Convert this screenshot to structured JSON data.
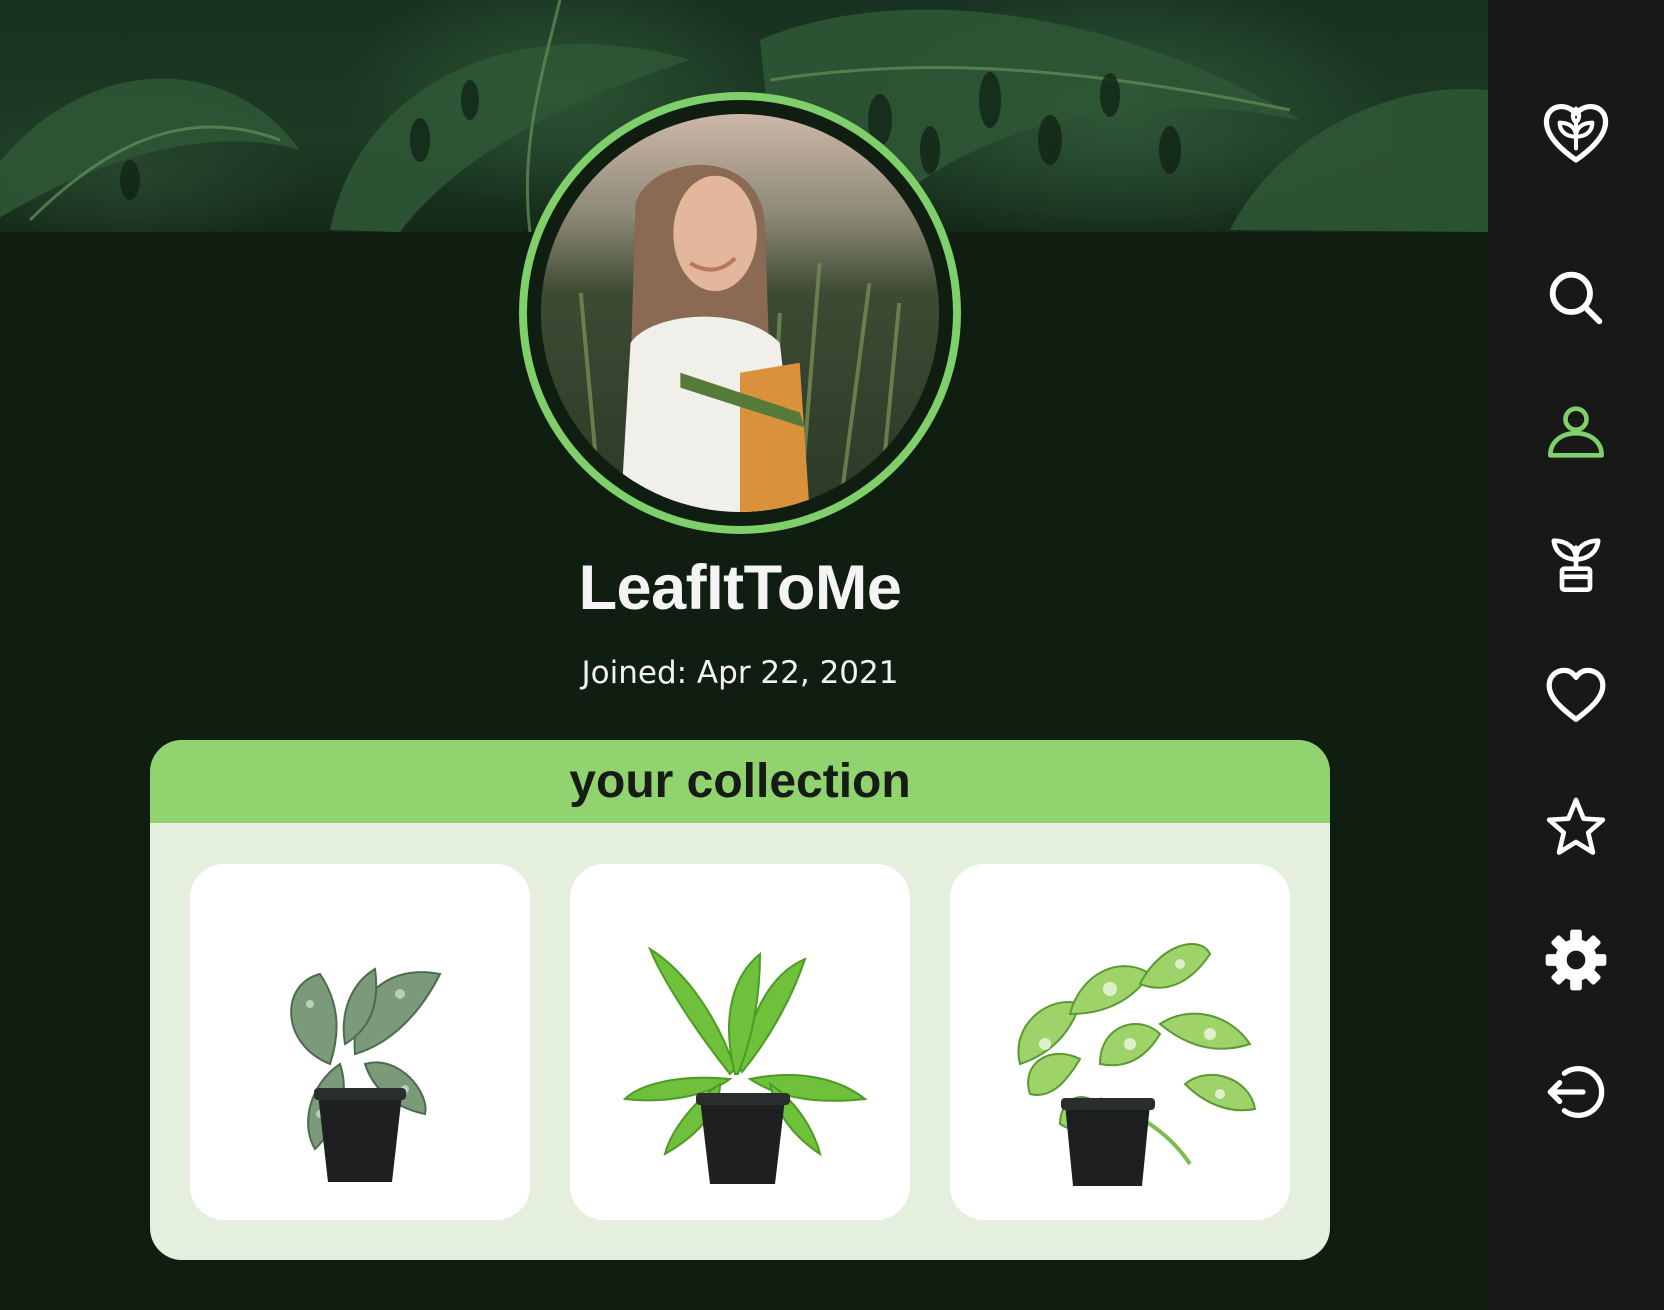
{
  "profile": {
    "username": "LeafItToMe",
    "joined": "Joined: Apr 22, 2021"
  },
  "collection": {
    "title": "your collection",
    "plants": [
      {
        "icon": "calathea-potted-plant"
      },
      {
        "icon": "birds-nest-fern-potted-plant"
      },
      {
        "icon": "pothos-potted-plant"
      }
    ]
  },
  "sidebar": {
    "items": [
      {
        "icon": "leaf-heart-logo-icon",
        "active": false
      },
      {
        "icon": "search-icon",
        "active": false
      },
      {
        "icon": "user-icon",
        "active": true
      },
      {
        "icon": "potted-plant-icon",
        "active": false
      },
      {
        "icon": "heart-icon",
        "active": false
      },
      {
        "icon": "star-icon",
        "active": false
      },
      {
        "icon": "gear-icon",
        "active": false
      },
      {
        "icon": "logout-icon",
        "active": false
      }
    ]
  },
  "colors": {
    "background": "#101e12",
    "accent": "#7fcf6a",
    "collection_header": "#91d36f",
    "collection_body": "#e4efde",
    "sidebar": "#181818",
    "sidebar_icon": "#ffffff",
    "sidebar_active_icon": "#7fcf6a"
  }
}
